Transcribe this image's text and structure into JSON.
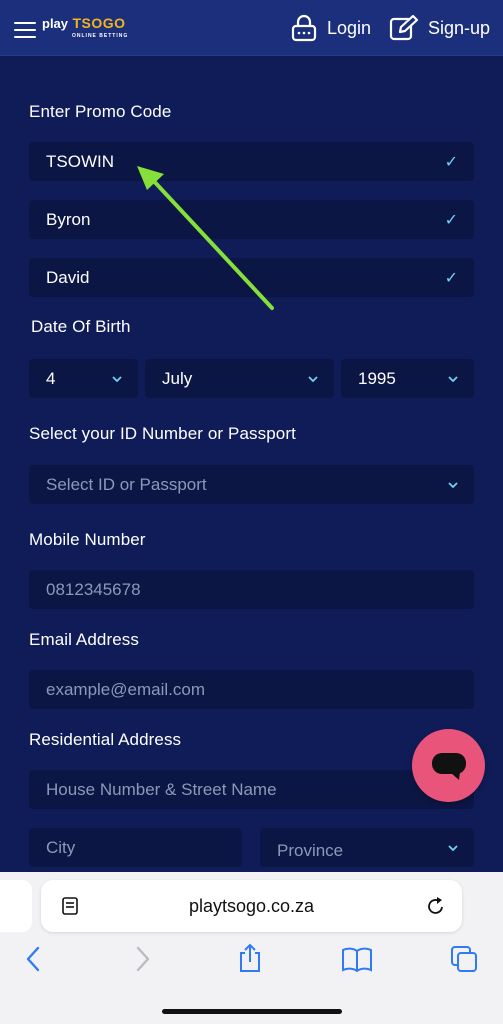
{
  "header": {
    "menu_icon": "hamburger-icon",
    "logo_play": "play",
    "logo_brand": "TSOGO",
    "logo_sub": "ONLINE BETTING",
    "login_label": "Login",
    "signup_label": "Sign-up",
    "bg_color": "#1b2f7c",
    "brand_color": "#f2b51c"
  },
  "form": {
    "promo_label": "Enter Promo Code",
    "promo_value": "TSOWIN",
    "first_name_value": "Byron",
    "last_name_value": "David",
    "dob_label": "Date Of Birth",
    "dob_day": "4",
    "dob_month": "July",
    "dob_year": "1995",
    "id_label": "Select your ID Number or Passport",
    "id_placeholder": "Select ID or Passport",
    "mobile_label": "Mobile Number",
    "mobile_placeholder": "0812345678",
    "email_label": "Email Address",
    "email_placeholder": "example@email.com",
    "address_label": "Residential Address",
    "street_placeholder": "House Number & Street Name",
    "city_placeholder": "City",
    "province_placeholder": "Province",
    "check_color": "#6fd3f5"
  },
  "annotation": {
    "arrow_color": "#86e03a"
  },
  "chat": {
    "bubble_color": "#e8547a",
    "icon": "chat-icon"
  },
  "browser": {
    "url": "playtsogo.co.za",
    "icons": [
      "page-menu-icon",
      "reload-icon",
      "back-icon",
      "forward-icon",
      "share-icon",
      "bookmarks-icon",
      "tabs-icon"
    ]
  }
}
